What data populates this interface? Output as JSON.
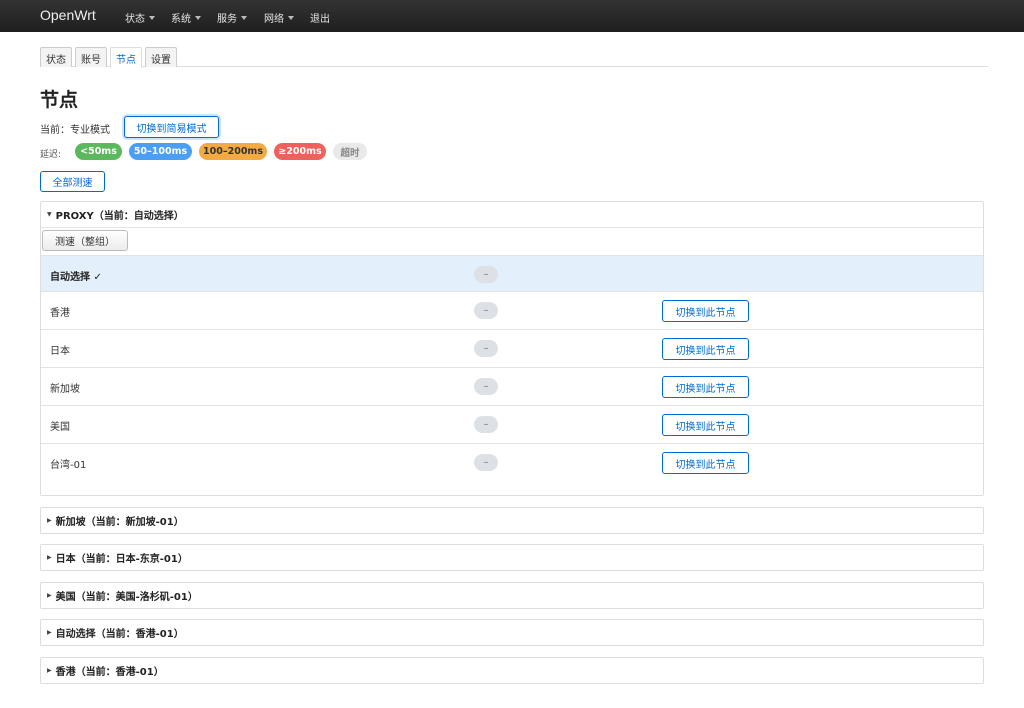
{
  "navbar": {
    "brand": "OpenWrt",
    "menus": [
      {
        "label": "状态",
        "has_caret": true
      },
      {
        "label": "系统",
        "has_caret": true
      },
      {
        "label": "服务",
        "has_caret": true
      },
      {
        "label": "网络",
        "has_caret": true
      },
      {
        "label": "退出",
        "has_caret": false
      }
    ]
  },
  "tabs": [
    "状态",
    "账号",
    "节点",
    "设置"
  ],
  "active_tab": "节点",
  "page": {
    "title": "节点",
    "mode_label": "当前：专业模式",
    "mode_button": "切换到简易模式",
    "delay_label": "延迟:",
    "legend": [
      {
        "label": "<50ms",
        "bg": "#5cb85c",
        "fg": "#ffffff"
      },
      {
        "label": "50–100ms",
        "bg": "#4a9ff5",
        "fg": "#ffffff"
      },
      {
        "label": "100–200ms",
        "bg": "#f5a941",
        "fg": "#333333"
      },
      {
        "label": "≥200ms",
        "bg": "#f0605d",
        "fg": "#ffffff"
      },
      {
        "label": "超时",
        "bg": "#e9e9e9",
        "fg": "#888888"
      }
    ],
    "test_all_button": "全部测速"
  },
  "expanded_group": {
    "title": "PROXY（当前：自动选择）",
    "test_button": "测速（整组）",
    "rows": [
      {
        "name": "自动选择 ✓",
        "delay": "–",
        "selected": true,
        "switch_label": ""
      },
      {
        "name": "香港",
        "delay": "–",
        "selected": false,
        "switch_label": "切换到此节点"
      },
      {
        "name": "日本",
        "delay": "–",
        "selected": false,
        "switch_label": "切换到此节点"
      },
      {
        "name": "新加坡",
        "delay": "–",
        "selected": false,
        "switch_label": "切换到此节点"
      },
      {
        "name": "美国",
        "delay": "–",
        "selected": false,
        "switch_label": "切换到此节点"
      },
      {
        "name": "台湾-01",
        "delay": "–",
        "selected": false,
        "switch_label": "切换到此节点"
      }
    ]
  },
  "collapsed_groups": [
    "新加坡（当前：新加坡-01）",
    "日本（当前：日本-东京-01）",
    "美国（当前：美国-洛杉矶-01）",
    "自动选择（当前：香港-01）",
    "香港（当前：香港-01）"
  ],
  "colors": {
    "accent": "#0069d6",
    "selected_row": "#e3effb",
    "navbar": "#222222"
  }
}
